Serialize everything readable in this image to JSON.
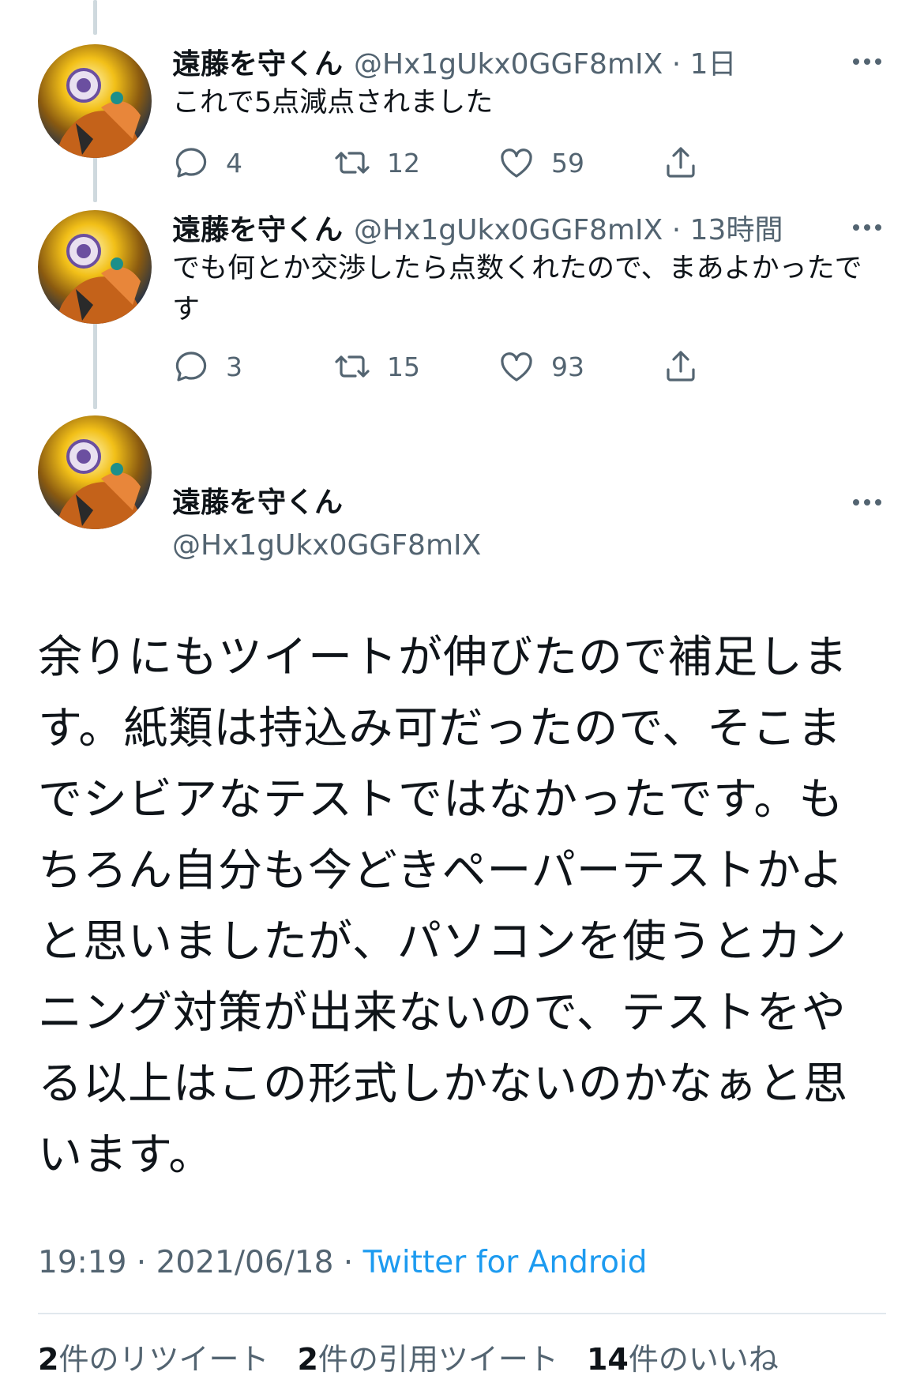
{
  "tweets": [
    {
      "name": "遠藤を守くん",
      "handle": "@Hx1gUkx0GGF8mIX",
      "time": "1日",
      "text": "これで5点減点されました",
      "replies": "4",
      "retweets": "12",
      "likes": "59"
    },
    {
      "name": "遠藤を守くん",
      "handle": "@Hx1gUkx0GGF8mIX",
      "time": "13時間",
      "text": "でも何とか交渉したら点数くれたので、まあよかったです",
      "replies": "3",
      "retweets": "15",
      "likes": "93"
    }
  ],
  "main": {
    "name": "遠藤を守くん",
    "handle": "@Hx1gUkx0GGF8mIX",
    "text": "余りにもツイートが伸びたので補足します。紙類は持込み可だったので、そこまでシビアなテストではなかったです。もちろん自分も今どきペーパーテストかよと思いましたが、パソコンを使うとカンニング対策が出来ないので、テストをやる以上はこの形式しかないのかなぁと思います。",
    "time": "19:19",
    "date": "2021/06/18",
    "source": "Twitter for Android",
    "retweet_count": "2",
    "retweet_label": "件のリツイート",
    "quote_count": "2",
    "quote_label": "件の引用ツイート",
    "like_count": "14",
    "like_label": "件のいいね"
  },
  "icons": [
    "reply-icon",
    "retweet-icon",
    "like-icon",
    "share-icon",
    "more-icon"
  ],
  "colors": {
    "link": "#1d9bf0",
    "muted": "#536471",
    "text": "#0f1419",
    "thread_line": "#cfd9de"
  }
}
